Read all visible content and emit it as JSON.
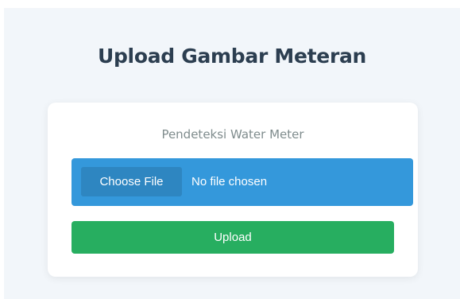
{
  "page": {
    "title": "Upload Gambar Meteran"
  },
  "card": {
    "subtitle": "Pendeteksi Water Meter",
    "file_input": {
      "button_label": "Choose File",
      "status": "No file chosen"
    },
    "upload_button_label": "Upload"
  },
  "colors": {
    "page_background": "#f2f6fa",
    "title_text": "#2c3e50",
    "subtitle_text": "#7f8c8d",
    "file_input_background": "#3498db",
    "choose_file_button": "#2e86c1",
    "upload_button": "#27ae60",
    "card_background": "#ffffff"
  }
}
